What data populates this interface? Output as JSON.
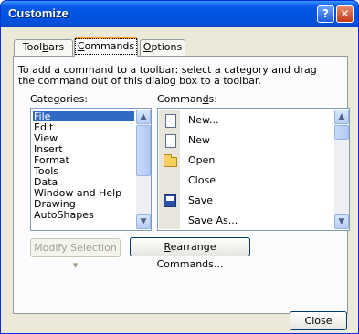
{
  "window": {
    "title": "Customize",
    "help_button": "?",
    "close_button": "✕"
  },
  "tabs": [
    {
      "pre": "Tool",
      "mnemonic": "b",
      "post": "ars",
      "selected": false
    },
    {
      "pre": "",
      "mnemonic": "C",
      "post": "ommands",
      "selected": true
    },
    {
      "pre": "",
      "mnemonic": "O",
      "post": "ptions",
      "selected": false
    }
  ],
  "instructions": "To add a command to a toolbar: select a category and drag the command out of this dialog box to a toolbar.",
  "categories": {
    "label_pre": "Cate",
    "label_mnemonic": "g",
    "label_post": "ories:",
    "items": [
      "File",
      "Edit",
      "View",
      "Insert",
      "Format",
      "Tools",
      "Data",
      "Window and Help",
      "Drawing",
      "AutoShapes"
    ],
    "selected": "File"
  },
  "commands": {
    "label_pre": "Comman",
    "label_mnemonic": "d",
    "label_post": "s:",
    "items": [
      {
        "label": "New...",
        "icon": "new-document-icon"
      },
      {
        "label": "New",
        "icon": "new-document-icon"
      },
      {
        "label": "Open",
        "icon": "open-folder-icon"
      },
      {
        "label": "Close",
        "icon": ""
      },
      {
        "label": "Save",
        "icon": "save-disk-icon"
      },
      {
        "label": "Save As...",
        "icon": ""
      }
    ]
  },
  "buttons": {
    "modify_selection": "Modify Selection",
    "modify_arrow": "▾",
    "rearrange_mnemonic": "R",
    "rearrange_rest": "earrange Commands...",
    "close": "Close"
  },
  "scroll_arrows": {
    "up": "▲",
    "down": "▼"
  },
  "colors": {
    "titlebar": "#0054e3",
    "selection": "#316ac5",
    "dialog_bg": "#ece9d8",
    "tab_highlight": "#ff9f20"
  }
}
